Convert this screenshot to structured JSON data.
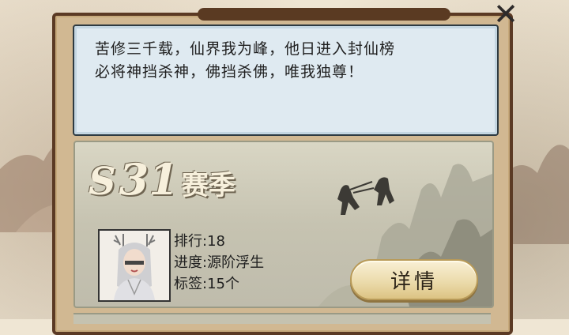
{
  "quote": {
    "line1": "苦修三千载，仙界我为峰，他日进入封仙榜",
    "line2": "必将神挡杀神，佛挡杀佛，唯我独尊！"
  },
  "season": {
    "prefix": "S",
    "number": "31",
    "word": "赛季"
  },
  "stats": {
    "rank": "排行:18",
    "progress": "进度:源阶浮生",
    "tags": "标签:15个"
  },
  "buttons": {
    "detail_label": "详情"
  },
  "colors": {
    "frame": "#5b3a24",
    "quote_bg": "#dfeaf1",
    "button_gold": "#ead9a8"
  },
  "icons": {
    "close": "close-x-icon"
  }
}
